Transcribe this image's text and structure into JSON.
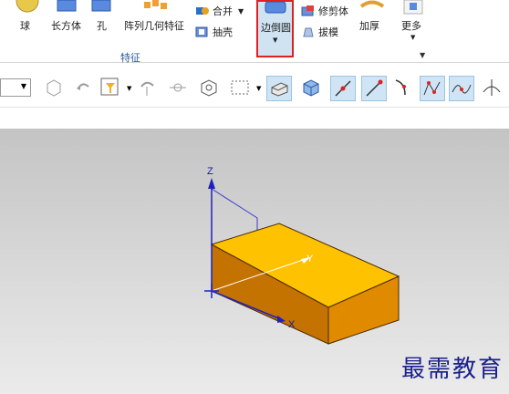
{
  "ribbon": {
    "items": [
      {
        "label": "球"
      },
      {
        "label": "长方体"
      },
      {
        "label": "孔"
      },
      {
        "label": "阵列几何特征"
      },
      {
        "label": "边倒圆"
      },
      {
        "label": "加厚"
      },
      {
        "label": "更多"
      }
    ],
    "small_items": [
      {
        "label": "合并"
      },
      {
        "label": "抽壳"
      },
      {
        "label": "修剪体"
      },
      {
        "label": "拔模"
      }
    ],
    "group_label": "特征",
    "highlight_color": "#e02020"
  },
  "viewport": {
    "axes": {
      "z": "Z",
      "y": "Y",
      "x": "X"
    },
    "block_colors": {
      "top": "#ffc200",
      "front": "#e08a00",
      "side": "#c47200"
    }
  },
  "watermark": "最需教育"
}
